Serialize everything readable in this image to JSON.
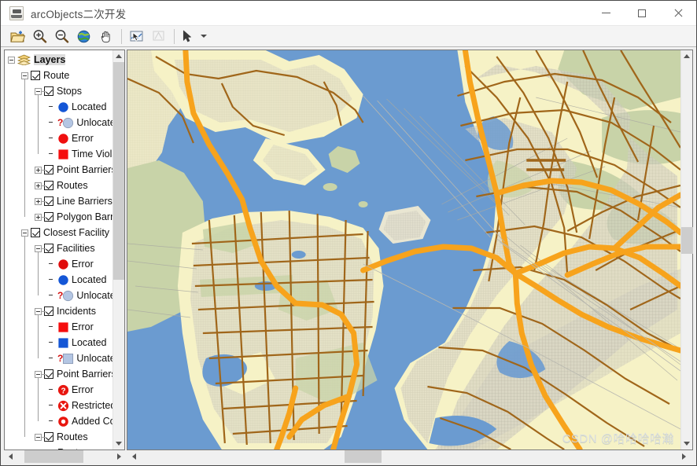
{
  "window": {
    "title": "arcObjects二次开发",
    "app_icon": "java-coffee-icon",
    "controls": {
      "minimize": "minimize-button",
      "maximize": "maximize-button",
      "close": "close-button"
    }
  },
  "toolbar": {
    "buttons": [
      {
        "name": "open-document",
        "icon": "open-folder-icon",
        "enabled": true
      },
      {
        "name": "zoom-in",
        "icon": "magnifier-plus-icon",
        "enabled": true
      },
      {
        "name": "zoom-out",
        "icon": "magnifier-minus-icon",
        "enabled": true
      },
      {
        "name": "full-extent",
        "icon": "globe-icon",
        "enabled": true
      },
      {
        "name": "pan",
        "icon": "hand-icon",
        "enabled": true
      },
      {
        "name": "select-features",
        "icon": "select-arrow-map-icon",
        "enabled": true
      },
      {
        "name": "identify",
        "icon": "identify-icon",
        "enabled": false
      },
      {
        "name": "select-tool",
        "icon": "arrow-cursor-icon",
        "enabled": true
      },
      {
        "name": "select-tool-dropdown",
        "icon": "chevron-down-icon",
        "enabled": true
      }
    ]
  },
  "tree": {
    "root_label": "Layers",
    "root_icon": "layers-stack-icon",
    "nodes": [
      {
        "label": "Layers",
        "depth": 0,
        "expander": "minus",
        "checkbox": null,
        "icon": "layers-stack-icon",
        "selected": true
      },
      {
        "label": "Route",
        "depth": 1,
        "expander": "minus",
        "checkbox": true,
        "icon": null
      },
      {
        "label": "Stops",
        "depth": 2,
        "expander": "minus",
        "checkbox": true,
        "icon": null
      },
      {
        "label": "Located",
        "depth": 3,
        "expander": "none",
        "checkbox": null,
        "icon": "circle",
        "color": "#1456d6"
      },
      {
        "label": "Unlocated",
        "depth": 3,
        "expander": "none",
        "checkbox": null,
        "icon": "circle-question",
        "color": "#b4c6e3"
      },
      {
        "label": "Error",
        "depth": 3,
        "expander": "none",
        "checkbox": null,
        "icon": "circle",
        "color": "#ef0f0f"
      },
      {
        "label": "Time Violation",
        "depth": 3,
        "expander": "none",
        "checkbox": null,
        "icon": "square",
        "color": "#f50d0d"
      },
      {
        "label": "Point Barriers",
        "depth": 2,
        "expander": "plus",
        "checkbox": true,
        "icon": null
      },
      {
        "label": "Routes",
        "depth": 2,
        "expander": "plus",
        "checkbox": true,
        "icon": null
      },
      {
        "label": "Line Barriers",
        "depth": 2,
        "expander": "plus",
        "checkbox": true,
        "icon": null
      },
      {
        "label": "Polygon Barriers",
        "depth": 2,
        "expander": "plus",
        "checkbox": true,
        "icon": null
      },
      {
        "label": "Closest Facility",
        "depth": 1,
        "expander": "minus",
        "checkbox": true,
        "icon": null
      },
      {
        "label": "Facilities",
        "depth": 2,
        "expander": "minus",
        "checkbox": true,
        "icon": null
      },
      {
        "label": "Error",
        "depth": 3,
        "expander": "none",
        "checkbox": null,
        "icon": "circle",
        "color": "#e00c0c"
      },
      {
        "label": "Located",
        "depth": 3,
        "expander": "none",
        "checkbox": null,
        "icon": "circle",
        "color": "#1456d6"
      },
      {
        "label": "Unlocated",
        "depth": 3,
        "expander": "none",
        "checkbox": null,
        "icon": "circle-question",
        "color": "#b4c6e3"
      },
      {
        "label": "Incidents",
        "depth": 2,
        "expander": "minus",
        "checkbox": true,
        "icon": null
      },
      {
        "label": "Error",
        "depth": 3,
        "expander": "none",
        "checkbox": null,
        "icon": "square",
        "color": "#f50d0d"
      },
      {
        "label": "Located",
        "depth": 3,
        "expander": "none",
        "checkbox": null,
        "icon": "square",
        "color": "#1456d6"
      },
      {
        "label": "Unlocated",
        "depth": 3,
        "expander": "none",
        "checkbox": null,
        "icon": "square-question",
        "color": "#b4c6e3"
      },
      {
        "label": "Point Barriers",
        "depth": 2,
        "expander": "minus",
        "checkbox": true,
        "icon": null
      },
      {
        "label": "Error",
        "depth": 3,
        "expander": "none",
        "checkbox": null,
        "icon": "badge-question",
        "color": "#e8160f"
      },
      {
        "label": "Restricted",
        "depth": 3,
        "expander": "none",
        "checkbox": null,
        "icon": "badge-x",
        "color": "#e8160f"
      },
      {
        "label": "Added Cost",
        "depth": 3,
        "expander": "none",
        "checkbox": null,
        "icon": "donut",
        "color": "#e8160f"
      },
      {
        "label": "Routes",
        "depth": 2,
        "expander": "minus",
        "checkbox": true,
        "icon": null
      },
      {
        "label": "Routes",
        "depth": 3,
        "expander": "none",
        "checkbox": null,
        "icon": null
      }
    ]
  },
  "map": {
    "name": "san-francisco-bay-area-map",
    "colors": {
      "water": "#6b9bd0",
      "land_pale": "#f6f2c6",
      "urban": "#c9c7bb",
      "park": "#c8d3a8",
      "highway": "#f7a31c",
      "major_road": "#a0661a",
      "minor_road": "#a9a9a1"
    },
    "watermark": "CSDN @哈哈哈哈瀚"
  },
  "scrollbars": {
    "tree_vertical": {
      "up": "scroll-up-arrow",
      "down": "scroll-down-arrow",
      "thumb_top_pct": 0,
      "thumb_height_pct": 58
    },
    "tree_horizontal": {
      "left": "scroll-left-arrow",
      "right": "scroll-right-arrow",
      "thumb_left_pct": 8,
      "thumb_width_pct": 62
    },
    "map_vertical": {
      "up": "scroll-up-arrow",
      "down": "scroll-down-arrow",
      "thumb_top_pct": 44,
      "thumb_height_pct": 7
    },
    "map_horizontal": {
      "left": "scroll-left-arrow",
      "right": "scroll-right-arrow",
      "thumb_left_pct": 38,
      "thumb_width_pct": 7
    }
  }
}
